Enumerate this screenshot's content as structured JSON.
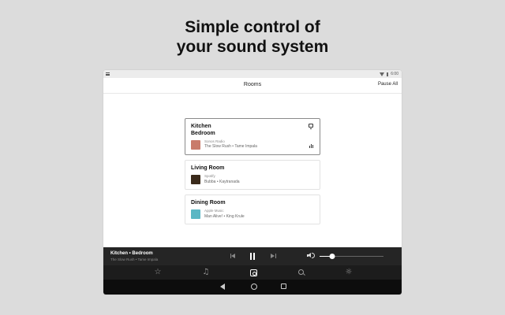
{
  "headline": {
    "line1": "Simple control of",
    "line2": "your sound system"
  },
  "status_bar": {
    "time": "6:00"
  },
  "app_bar": {
    "title": "Rooms",
    "action": "Pause All"
  },
  "rooms": [
    {
      "name_line1": "Kitchen",
      "name_line2": "Bedroom",
      "source": "Sonos Radio",
      "track": "The Slow Rush • Tame Impala",
      "art_color": "#c97b6a",
      "selected": true
    },
    {
      "name_line1": "Living Room",
      "source": "Spotify",
      "track": "Bubba • Kaytranada",
      "art_color": "#3a2a1a",
      "selected": false
    },
    {
      "name_line1": "Dining Room",
      "source": "Apple Music",
      "track": "Man Alive! • King Krule",
      "art_color": "#5bb7c4",
      "selected": false
    }
  ],
  "now_playing": {
    "title": "Kitchen • Bedroom",
    "subtitle": "The Slow Rush • Tame Impala",
    "volume": 0.2
  },
  "tabs": [
    {
      "icon": "star-icon",
      "glyph": "☆"
    },
    {
      "icon": "music-note-icon",
      "glyph": "♫"
    },
    {
      "icon": "rooms-icon",
      "glyph": ""
    },
    {
      "icon": "search-icon",
      "glyph": ""
    },
    {
      "icon": "settings-icon",
      "glyph": "☼"
    }
  ],
  "colors": {
    "player_bg": "#252525",
    "tabbar_bg": "#1c1c1c",
    "navbar_bg": "#0d0d0d",
    "page_bg": "#dcdcdc"
  }
}
